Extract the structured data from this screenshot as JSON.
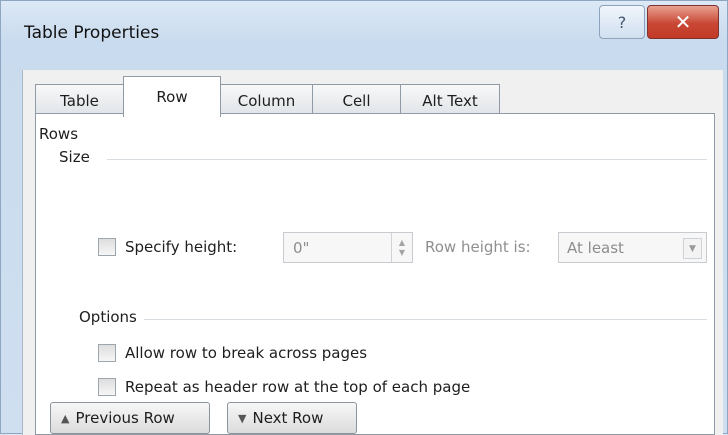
{
  "window": {
    "title": "Table Properties",
    "help_icon": "?",
    "close_icon": "✕"
  },
  "tabs": [
    {
      "label": "Table",
      "active": false
    },
    {
      "label": "Row",
      "active": true
    },
    {
      "label": "Column",
      "active": false
    },
    {
      "label": "Cell",
      "active": false
    },
    {
      "label": "Alt Text",
      "active": false
    }
  ],
  "rows_section": {
    "heading": "Rows",
    "size_group": "Size",
    "specify_height_label": "Specify height:",
    "specify_height_checked": false,
    "height_value": "0\"",
    "row_height_is_label": "Row height is:",
    "row_height_is_value": "At least",
    "options_group": "Options",
    "allow_break_label": "Allow row to break across pages",
    "allow_break_checked": false,
    "repeat_header_label": "Repeat as header row at the top of each page",
    "repeat_header_checked": false
  },
  "buttons": {
    "previous_row": "Previous Row",
    "next_row": "Next Row",
    "up_arrow": "▲",
    "down_arrow": "▼"
  }
}
